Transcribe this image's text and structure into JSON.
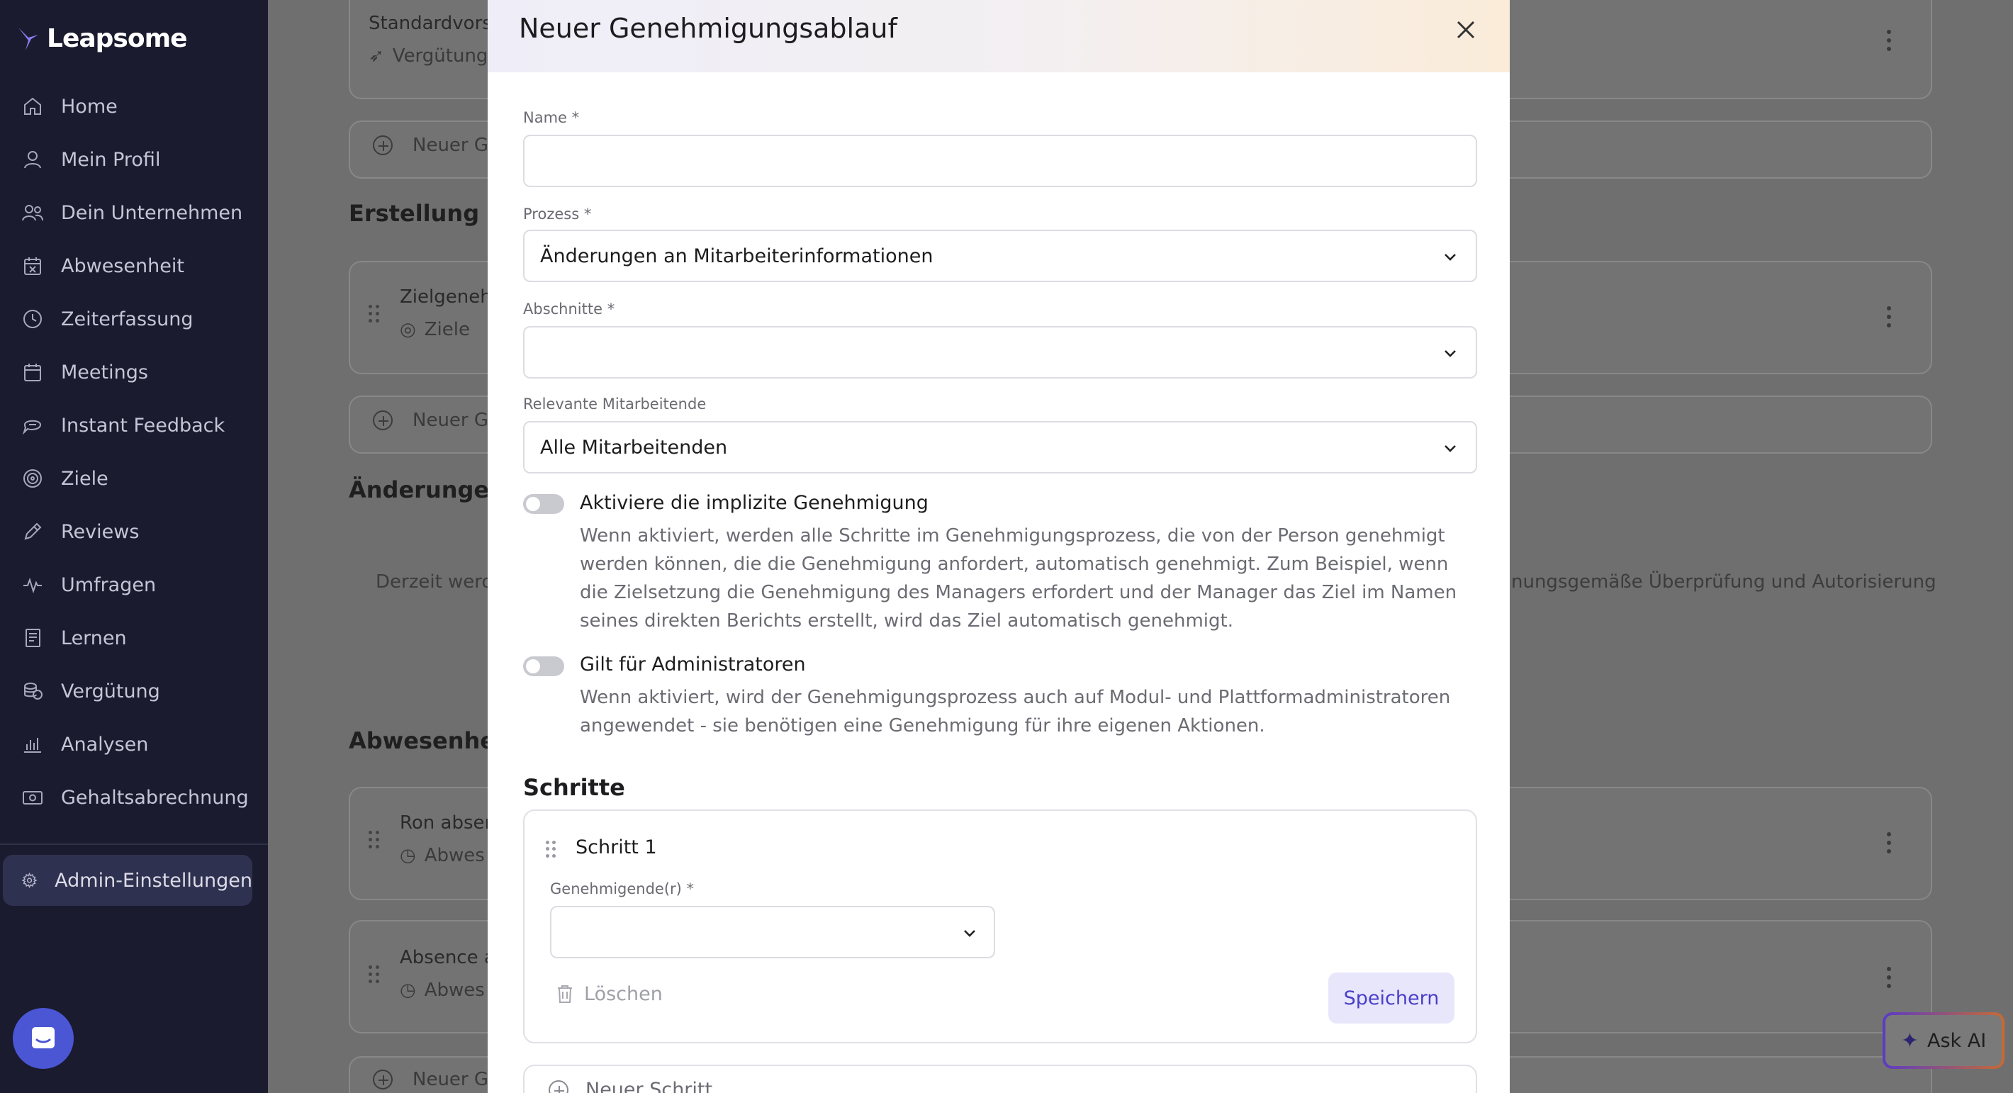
{
  "app": {
    "logo_text": "Leapsome"
  },
  "sidebar": {
    "items": [
      {
        "label": "Home",
        "icon": "home-icon"
      },
      {
        "label": "Mein Profil",
        "icon": "user-icon"
      },
      {
        "label": "Dein Unternehmen",
        "icon": "users-icon"
      },
      {
        "label": "Abwesenheit",
        "icon": "calendar-x-icon"
      },
      {
        "label": "Zeiterfassung",
        "icon": "clock-icon"
      },
      {
        "label": "Meetings",
        "icon": "calendar-icon"
      },
      {
        "label": "Instant Feedback",
        "icon": "chat-icon"
      },
      {
        "label": "Ziele",
        "icon": "target-icon"
      },
      {
        "label": "Reviews",
        "icon": "pencil-icon"
      },
      {
        "label": "Umfragen",
        "icon": "pulse-icon"
      },
      {
        "label": "Lernen",
        "icon": "book-icon"
      },
      {
        "label": "Vergütung",
        "icon": "coins-icon"
      },
      {
        "label": "Analysen",
        "icon": "bar-chart-icon"
      },
      {
        "label": "Gehaltsabrechnung",
        "icon": "money-icon"
      }
    ],
    "admin_label": "Admin-Einstellungen"
  },
  "background": {
    "card1_title": "Standardvorsc",
    "card1_sub": "Vergütung",
    "new_flow_1": "Neuer G",
    "heading_2": "Erstellung ind",
    "card2_title": "Zielgenehi",
    "card2_sub": "Ziele",
    "new_flow_2": "Neuer G",
    "heading_3": "Änderungen a",
    "empty_left": "Derzeit werd",
    "empty_right": "nungsgemäße Überprüfung und Autorisierung",
    "heading_4": "Abwesenheit",
    "card3_title": "Ron absen",
    "card3_sub": "Abwes",
    "card4_title": "Absence a",
    "card4_sub": "Abwes",
    "new_flow_3": "Neuer G"
  },
  "ask_ai": {
    "label": "Ask AI"
  },
  "modal": {
    "title": "Neuer Genehmigungsablauf",
    "name_label": "Name *",
    "name_value": "",
    "process_label": "Prozess *",
    "process_value": "Änderungen an Mitarbeiterinformationen",
    "sections_label": "Abschnitte *",
    "sections_value": "",
    "employees_label": "Relevante Mitarbeitende",
    "employees_value": "Alle Mitarbeitenden",
    "implicit_title": "Aktiviere die implizite Genehmigung",
    "implicit_desc": "Wenn aktiviert, werden alle Schritte im Genehmigungsprozess, die von der Person genehmigt werden können, die die Genehmigung anfordert, automatisch genehmigt. Zum Beispiel, wenn die Zielsetzung die Genehmigung des Managers erfordert und der Manager das Ziel im Namen seines direkten Berichts erstellt, wird das Ziel automatisch genehmigt.",
    "admins_title": "Gilt für Administratoren",
    "admins_desc": "Wenn aktiviert, wird der Genehmigungsprozess auch auf Modul- und Plattformadministratoren angewendet - sie benötigen eine Genehmigung für ihre eigenen Aktionen.",
    "steps_title": "Schritte",
    "step": {
      "title": "Schritt 1",
      "approver_label": "Genehmigende(r) *",
      "approver_value": "",
      "delete_label": "Löschen",
      "save_label": "Speichern"
    },
    "new_step_label": "Neuer Schritt"
  },
  "colors": {
    "sidebar_bg": "#1a1b2e",
    "accent": "#4a3fc9",
    "overlay": "#6f6f6f"
  }
}
